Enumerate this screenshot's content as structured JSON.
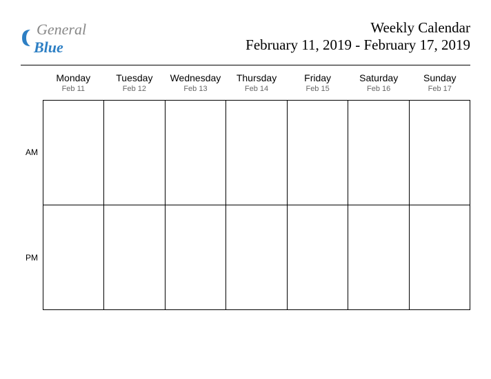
{
  "logo": {
    "text1": "General",
    "text2": "Blue",
    "swoosh_color": "#2d7fc4"
  },
  "title": {
    "main": "Weekly Calendar",
    "range": "February 11, 2019 - February 17, 2019"
  },
  "days": [
    {
      "name": "Monday",
      "date": "Feb 11"
    },
    {
      "name": "Tuesday",
      "date": "Feb 12"
    },
    {
      "name": "Wednesday",
      "date": "Feb 13"
    },
    {
      "name": "Thursday",
      "date": "Feb 14"
    },
    {
      "name": "Friday",
      "date": "Feb 15"
    },
    {
      "name": "Saturday",
      "date": "Feb 16"
    },
    {
      "name": "Sunday",
      "date": "Feb 17"
    }
  ],
  "rows": [
    "AM",
    "PM"
  ]
}
